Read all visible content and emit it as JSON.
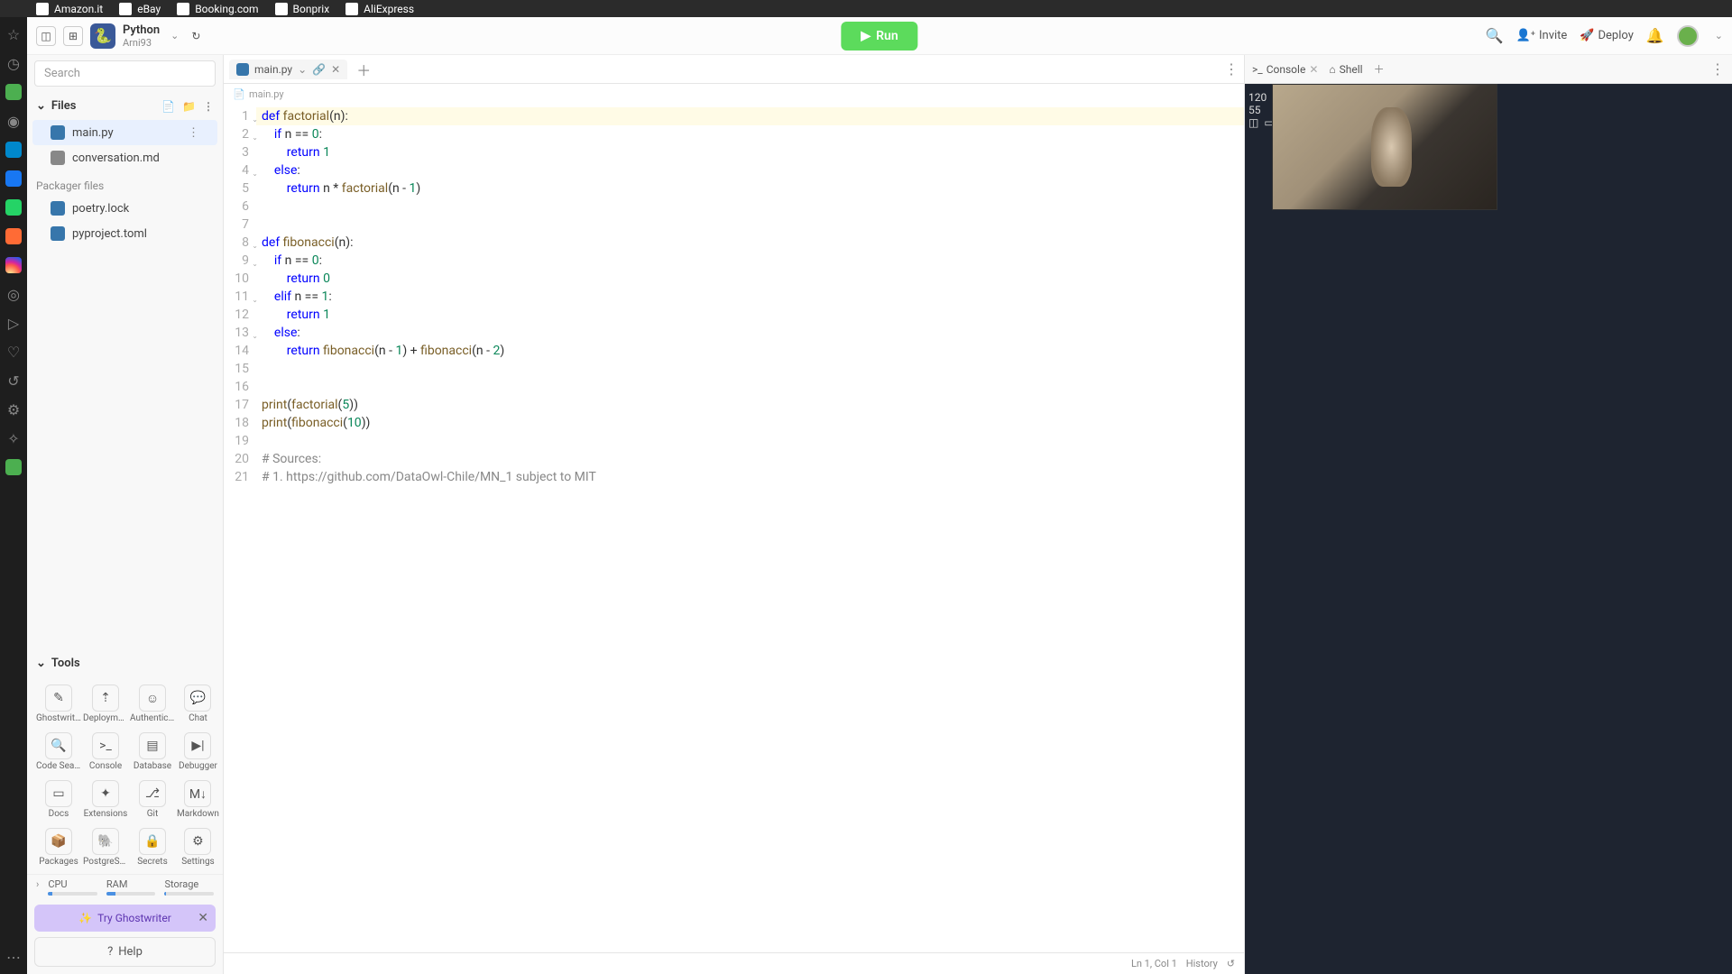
{
  "browser_tabs": [
    "Amazon.it",
    "eBay",
    "Booking.com",
    "Bonprix",
    "AliExpress"
  ],
  "project": {
    "name": "Python",
    "user": "Arni93"
  },
  "run_label": "Run",
  "topbar": {
    "invite": "Invite",
    "deploy": "Deploy"
  },
  "search_placeholder": "Search",
  "files_header": "Files",
  "files": [
    {
      "name": "main.py",
      "icon": "py",
      "active": true
    },
    {
      "name": "conversation.md",
      "icon": "md",
      "active": false
    }
  ],
  "packager_header": "Packager files",
  "packager_files": [
    {
      "name": "poetry.lock",
      "icon": "py"
    },
    {
      "name": "pyproject.toml",
      "icon": "py"
    }
  ],
  "tools_header": "Tools",
  "tools": [
    {
      "label": "Ghostwriter",
      "glyph": "✎"
    },
    {
      "label": "Deployments",
      "glyph": "⇡"
    },
    {
      "label": "Authenticat…",
      "glyph": "☺"
    },
    {
      "label": "Chat",
      "glyph": "💬"
    },
    {
      "label": "Code Search",
      "glyph": "🔍"
    },
    {
      "label": "Console",
      "glyph": ">_"
    },
    {
      "label": "Database",
      "glyph": "▤"
    },
    {
      "label": "Debugger",
      "glyph": "▶|"
    },
    {
      "label": "Docs",
      "glyph": "▭"
    },
    {
      "label": "Extensions",
      "glyph": "✦"
    },
    {
      "label": "Git",
      "glyph": "⎇"
    },
    {
      "label": "Markdown",
      "glyph": "M↓"
    },
    {
      "label": "Packages",
      "glyph": "📦"
    },
    {
      "label": "PostgreSQL",
      "glyph": "🐘"
    },
    {
      "label": "Secrets",
      "glyph": "🔒"
    },
    {
      "label": "Settings",
      "glyph": "⚙"
    }
  ],
  "resources": [
    {
      "name": "CPU",
      "pct": 8
    },
    {
      "name": "RAM",
      "pct": 18
    },
    {
      "name": "Storage",
      "pct": 3
    }
  ],
  "ghostwriter_pill": "Try Ghostwriter",
  "help_label": "Help",
  "editor": {
    "tab": "main.py",
    "breadcrumb": "main.py",
    "lines": [
      {
        "n": 1,
        "fold": true,
        "tokens": [
          [
            "kw",
            "def "
          ],
          [
            "fn",
            "factorial"
          ],
          [
            "",
            "(n):"
          ]
        ]
      },
      {
        "n": 2,
        "fold": true,
        "tokens": [
          [
            "",
            "    "
          ],
          [
            "kw",
            "if"
          ],
          [
            "",
            " n == "
          ],
          [
            "num",
            "0"
          ],
          [
            "",
            ":"
          ]
        ]
      },
      {
        "n": 3,
        "tokens": [
          [
            "",
            "        "
          ],
          [
            "kw",
            "return"
          ],
          [
            "",
            " "
          ],
          [
            "num",
            "1"
          ]
        ]
      },
      {
        "n": 4,
        "fold": true,
        "tokens": [
          [
            "",
            "    "
          ],
          [
            "kw",
            "else"
          ],
          [
            "",
            ":"
          ]
        ]
      },
      {
        "n": 5,
        "tokens": [
          [
            "",
            "        "
          ],
          [
            "kw",
            "return"
          ],
          [
            "",
            " n * "
          ],
          [
            "fn",
            "factorial"
          ],
          [
            "",
            "(n - "
          ],
          [
            "num",
            "1"
          ],
          [
            "",
            ")"
          ]
        ]
      },
      {
        "n": 6,
        "tokens": [
          [
            "",
            ""
          ]
        ]
      },
      {
        "n": 7,
        "tokens": [
          [
            "",
            ""
          ]
        ]
      },
      {
        "n": 8,
        "fold": true,
        "tokens": [
          [
            "kw",
            "def "
          ],
          [
            "fn",
            "fibonacci"
          ],
          [
            "",
            "(n):"
          ]
        ]
      },
      {
        "n": 9,
        "fold": true,
        "tokens": [
          [
            "",
            "    "
          ],
          [
            "kw",
            "if"
          ],
          [
            "",
            " n == "
          ],
          [
            "num",
            "0"
          ],
          [
            "",
            ":"
          ]
        ]
      },
      {
        "n": 10,
        "tokens": [
          [
            "",
            "        "
          ],
          [
            "kw",
            "return"
          ],
          [
            "",
            " "
          ],
          [
            "num",
            "0"
          ]
        ]
      },
      {
        "n": 11,
        "fold": true,
        "tokens": [
          [
            "",
            "    "
          ],
          [
            "kw",
            "elif"
          ],
          [
            "",
            " n == "
          ],
          [
            "num",
            "1"
          ],
          [
            "",
            ":"
          ]
        ]
      },
      {
        "n": 12,
        "tokens": [
          [
            "",
            "        "
          ],
          [
            "kw",
            "return"
          ],
          [
            "",
            " "
          ],
          [
            "num",
            "1"
          ]
        ]
      },
      {
        "n": 13,
        "fold": true,
        "tokens": [
          [
            "",
            "    "
          ],
          [
            "kw",
            "else"
          ],
          [
            "",
            ":"
          ]
        ]
      },
      {
        "n": 14,
        "tokens": [
          [
            "",
            "        "
          ],
          [
            "kw",
            "return"
          ],
          [
            "",
            " "
          ],
          [
            "fn",
            "fibonacci"
          ],
          [
            "",
            "(n - "
          ],
          [
            "num",
            "1"
          ],
          [
            "",
            ") + "
          ],
          [
            "fn",
            "fibonacci"
          ],
          [
            "",
            "(n - "
          ],
          [
            "num",
            "2"
          ],
          [
            "",
            ")"
          ]
        ]
      },
      {
        "n": 15,
        "tokens": [
          [
            "",
            ""
          ]
        ]
      },
      {
        "n": 16,
        "tokens": [
          [
            "",
            ""
          ]
        ]
      },
      {
        "n": 17,
        "tokens": [
          [
            "fn",
            "print"
          ],
          [
            "",
            "("
          ],
          [
            "fn",
            "factorial"
          ],
          [
            "",
            "("
          ],
          [
            "num",
            "5"
          ],
          [
            "",
            "))"
          ]
        ]
      },
      {
        "n": 18,
        "tokens": [
          [
            "fn",
            "print"
          ],
          [
            "",
            "("
          ],
          [
            "fn",
            "fibonacci"
          ],
          [
            "",
            "("
          ],
          [
            "num",
            "10"
          ],
          [
            "",
            "))"
          ]
        ]
      },
      {
        "n": 19,
        "tokens": [
          [
            "",
            ""
          ]
        ]
      },
      {
        "n": 20,
        "tokens": [
          [
            "cm",
            "# Sources:"
          ]
        ]
      },
      {
        "n": 21,
        "tokens": [
          [
            "cm",
            "# 1. https://github.com/DataOwl-Chile/MN_1 subject to MIT"
          ]
        ]
      }
    ],
    "status_pos": "Ln 1, Col 1",
    "status_history": "History"
  },
  "console": {
    "tab1": "Console",
    "tab2": "Shell",
    "metric1": "120",
    "metric2": "55"
  }
}
